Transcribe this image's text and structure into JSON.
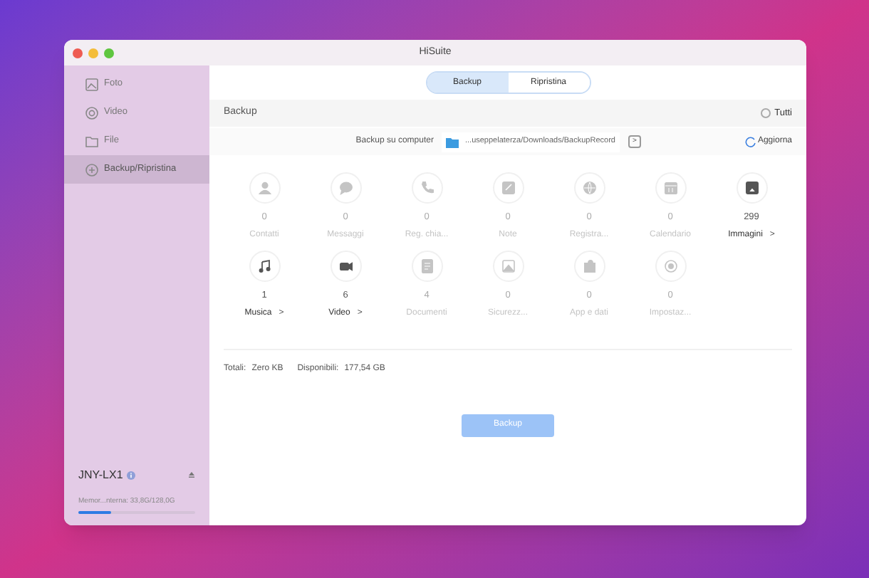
{
  "window": {
    "title": "HiSuite"
  },
  "sidebar": {
    "items": [
      {
        "label": "Foto",
        "selected": false
      },
      {
        "label": "Video",
        "selected": false
      },
      {
        "label": "File",
        "selected": false
      },
      {
        "label": "Backup/Ripristina",
        "selected": true
      }
    ],
    "device": {
      "name": "JNY-LX1",
      "storage": "Memor...nterna: 33,8G/128,0G",
      "level": 0.28
    }
  },
  "tabs": [
    {
      "label": "Backup",
      "selected": true
    },
    {
      "label": "Ripristina",
      "selected": false
    }
  ],
  "section": {
    "title": "Backup",
    "select_all": {
      "label": "Tutti",
      "checked": false
    }
  },
  "destination": {
    "label": "Backup su computer",
    "path": "...useppelaterza/Downloads/BackupRecord",
    "browse": ">",
    "refresh": "Aggiorna"
  },
  "categories": [
    {
      "count": "0",
      "label": "Contatti",
      "enabled": false
    },
    {
      "count": "0",
      "label": "Messaggi",
      "enabled": false
    },
    {
      "count": "0",
      "label": "Reg. chia...",
      "enabled": false
    },
    {
      "count": "0",
      "label": "Note",
      "enabled": false
    },
    {
      "count": "0",
      "label": "Registra...",
      "enabled": false
    },
    {
      "count": "0",
      "label": "Calendario",
      "enabled": false
    },
    {
      "count": "299",
      "label": "Immagini",
      "arrow": ">",
      "enabled": true
    },
    {
      "count": "1",
      "label": "Musica",
      "arrow": ">",
      "enabled": true
    },
    {
      "count": "6",
      "label": "Video",
      "arrow": ">",
      "enabled": true
    },
    {
      "count": "4",
      "label": "Documenti",
      "enabled": false
    },
    {
      "count": "0",
      "label": "Sicurezz...",
      "enabled": false
    },
    {
      "count": "0",
      "label": "App e dati",
      "enabled": false
    },
    {
      "count": "0",
      "label": "Impostaz...",
      "enabled": false
    }
  ],
  "summary": {
    "total_label": "Totali:",
    "total": "Zero KB",
    "free_label": "Disponibili:",
    "free": "177,54 GB"
  },
  "backup_button": {
    "label": "Backup",
    "disabled": true
  }
}
